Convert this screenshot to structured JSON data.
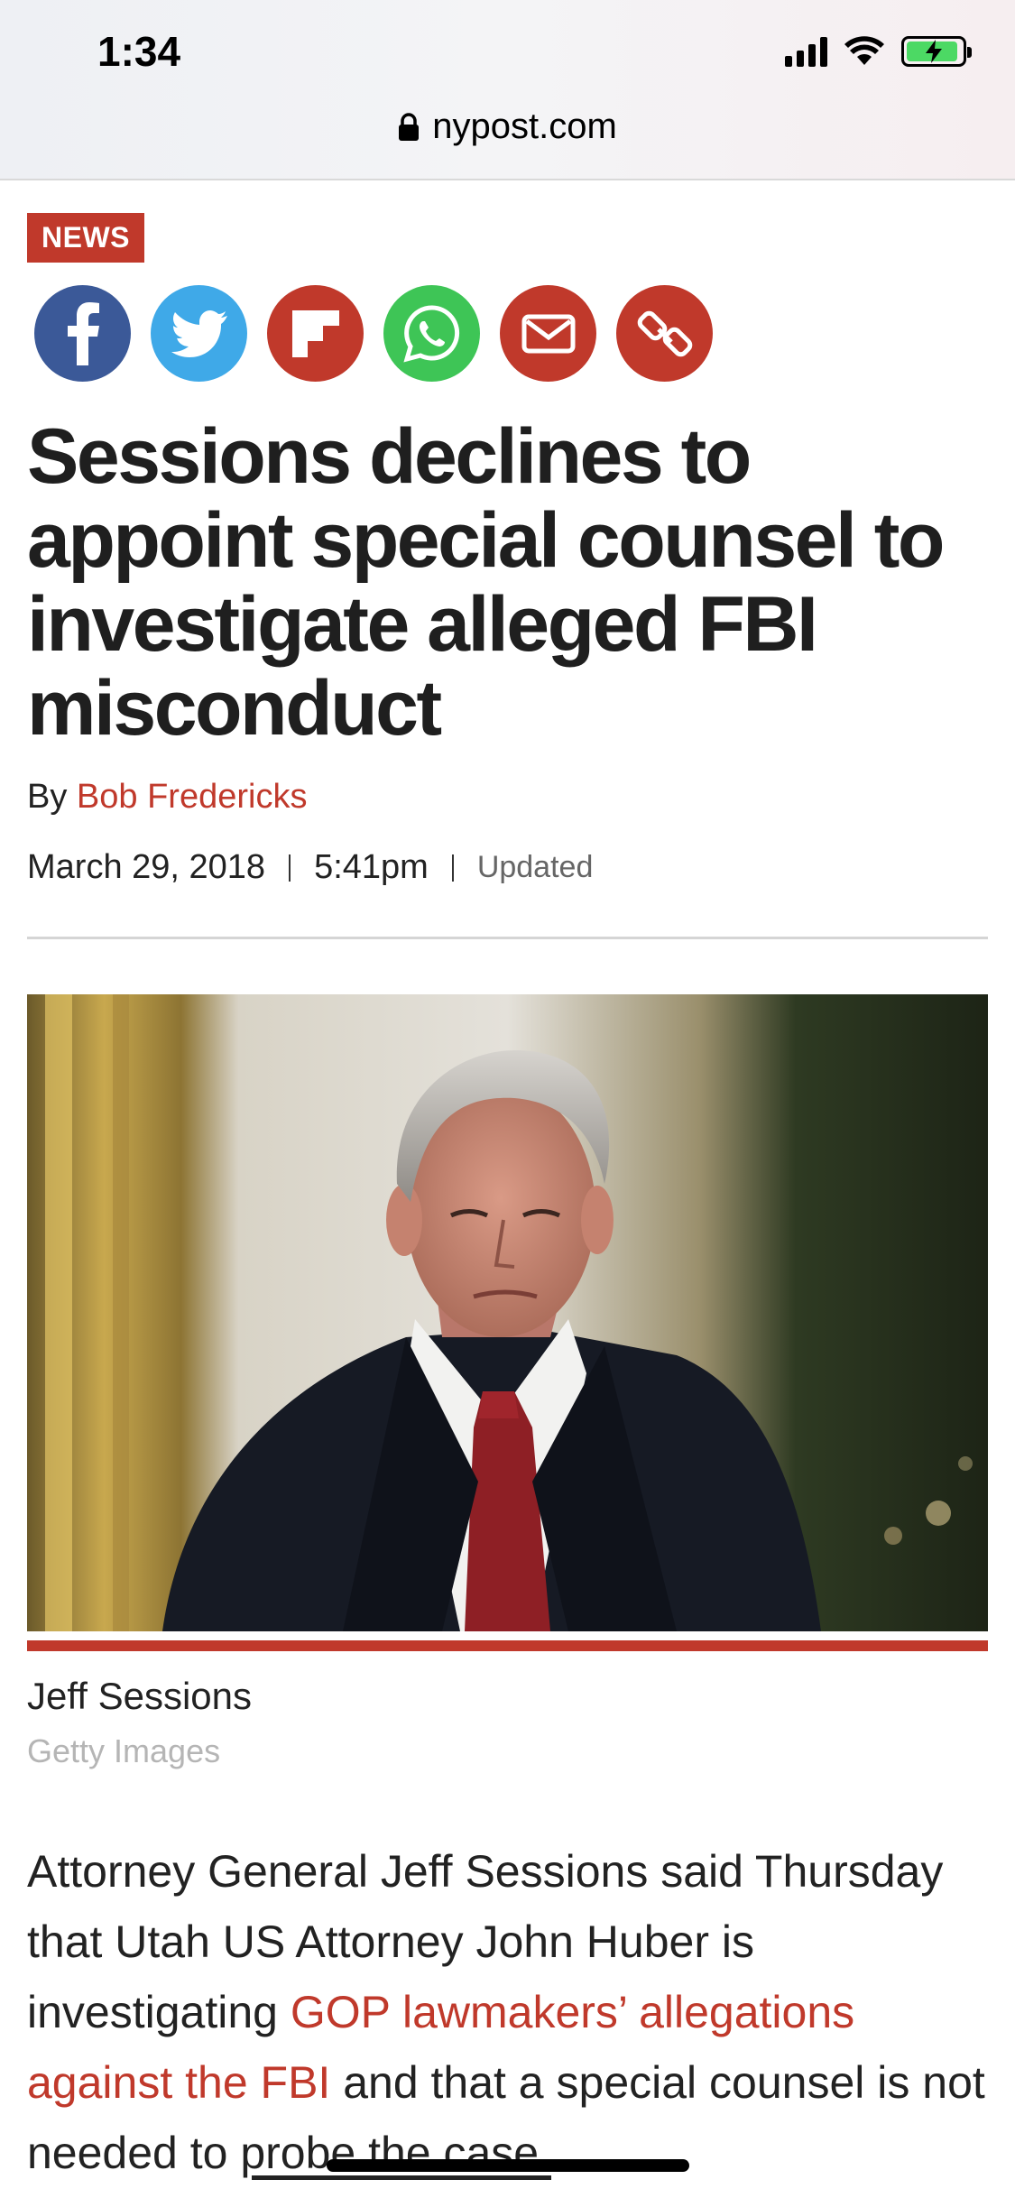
{
  "status_bar": {
    "time": "1:34"
  },
  "browser": {
    "url": "nypost.com"
  },
  "article": {
    "section": "NEWS",
    "share_buttons": [
      {
        "name": "facebook",
        "color": "#3b5998"
      },
      {
        "name": "twitter",
        "color": "#3fa9e8"
      },
      {
        "name": "flipboard",
        "color": "#c0392b"
      },
      {
        "name": "whatsapp",
        "color": "#3ec556"
      },
      {
        "name": "email",
        "color": "#c0392b"
      },
      {
        "name": "link",
        "color": "#c0392b"
      }
    ],
    "headline": "Sessions declines to appoint special counsel to investigate alleged FBI misconduct",
    "byline_prefix": "By",
    "author": "Bob Fredericks",
    "date": "March 29, 2018",
    "time": "5:41pm",
    "updated_label": "Updated",
    "photo_caption": "Jeff Sessions",
    "photo_credit": "Getty Images",
    "body": {
      "part1": "Attorney General Jeff Sessions said Thursday that Utah US Attorney John Huber is investigating ",
      "link1": "GOP lawmakers’ allegations against the FBI",
      "part2": " and that a special counsel is not needed to ",
      "link2": "probe the case."
    }
  },
  "colors": {
    "accent": "#c0392b"
  }
}
